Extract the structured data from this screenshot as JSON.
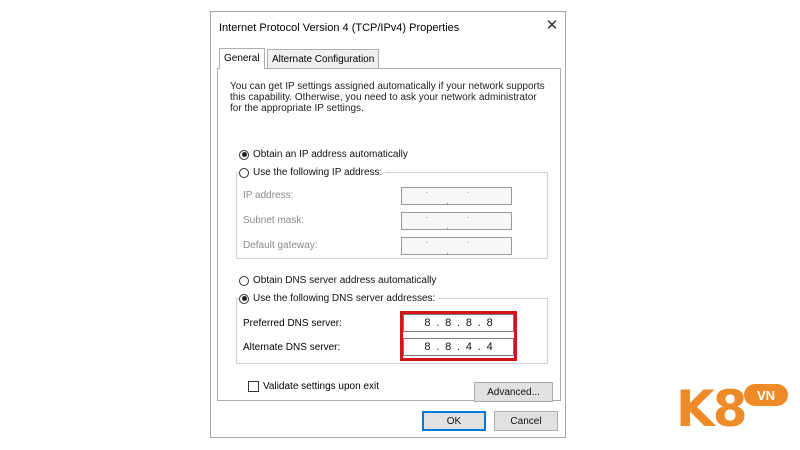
{
  "dialog": {
    "title": "Internet Protocol Version 4 (TCP/IPv4) Properties",
    "tabs": [
      {
        "label": "General",
        "active": true
      },
      {
        "label": "Alternate Configuration",
        "active": false
      }
    ],
    "description": "You can get IP settings assigned automatically if your network supports this capability. Otherwise, you need to ask your network administrator for the appropriate IP settings.",
    "ip_section": {
      "auto_label": "Obtain an IP address automatically",
      "manual_label": "Use the following IP address:",
      "selected": "auto",
      "fields": [
        {
          "label": "IP address:",
          "value": ". . ."
        },
        {
          "label": "Subnet mask:",
          "value": ". . ."
        },
        {
          "label": "Default gateway:",
          "value": ". . ."
        }
      ]
    },
    "dns_section": {
      "auto_label": "Obtain DNS server address automatically",
      "manual_label": "Use the following DNS server addresses:",
      "selected": "manual",
      "preferred": {
        "label": "Preferred DNS server:",
        "octets": [
          "8",
          "8",
          "8",
          "8"
        ]
      },
      "alternate": {
        "label": "Alternate DNS server:",
        "octets": [
          "8",
          "8",
          "4",
          "4"
        ]
      }
    },
    "validate_label": "Validate settings upon exit",
    "validate_checked": false,
    "buttons": {
      "advanced": "Advanced...",
      "ok": "OK",
      "cancel": "Cancel"
    }
  },
  "watermark": {
    "brand": "K8",
    "badge": "VN"
  },
  "colors": {
    "highlight": "#d3141b",
    "ok_border": "#0078d7",
    "brand": "#ee8a28"
  }
}
